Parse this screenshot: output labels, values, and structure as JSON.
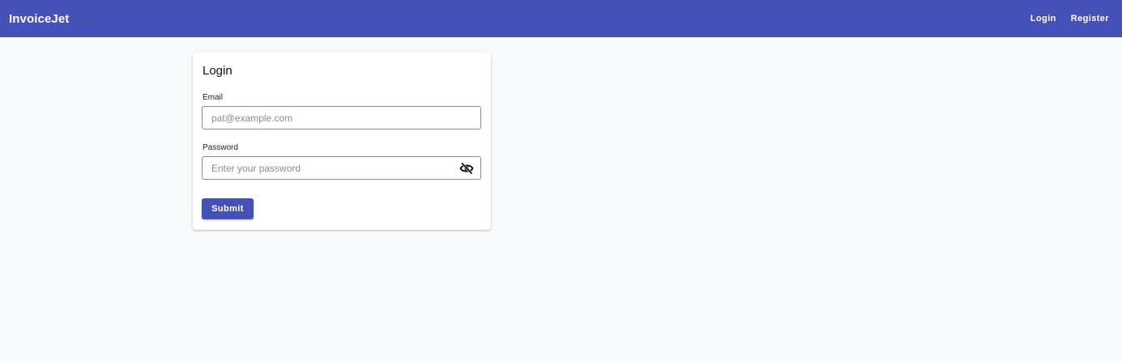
{
  "app": {
    "brand": "InvoiceJet",
    "accent_color": "#4651b7"
  },
  "nav": {
    "items": [
      {
        "label": "Login"
      },
      {
        "label": "Register"
      }
    ]
  },
  "login_card": {
    "title": "Login",
    "email": {
      "label": "Email",
      "value": "",
      "placeholder": "pat@example.com"
    },
    "password": {
      "label": "Password",
      "value": "",
      "placeholder": "Enter your password",
      "visibility_icon": "eye-off-icon"
    },
    "submit_label": "Submit"
  }
}
